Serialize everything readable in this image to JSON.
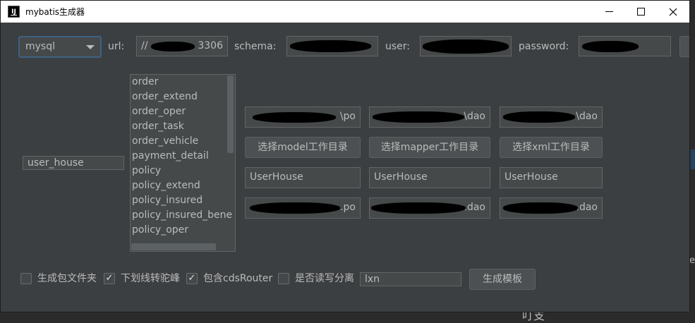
{
  "window": {
    "title": "mybatis生成器",
    "icon_text": "IJ",
    "minimize_icon": "minimize-icon",
    "maximize_icon": "maximize-icon",
    "close_icon": "close-icon"
  },
  "connection": {
    "db_type": "mysql",
    "url_label": "url:",
    "url_value": "//",
    "url_suffix": "3306",
    "schema_label": "schema:",
    "user_label": "user:",
    "password_label": "password:"
  },
  "table_input": "user_house",
  "tables": [
    "order",
    "order_extend",
    "order_oper",
    "order_task",
    "order_vehicle",
    "payment_detail",
    "policy",
    "policy_extend",
    "policy_insured",
    "policy_insured_bene",
    "policy_oper"
  ],
  "paths": {
    "model_dir_suffix": "\\po",
    "mapper_dir_suffix": "\\dao",
    "xml_dir_suffix": "\\dao"
  },
  "buttons": {
    "choose_model": "选择model工作目录",
    "choose_mapper": "选择mapper工作目录",
    "choose_xml": "选择xml工作目录",
    "generate": "生成模板"
  },
  "names": {
    "model_name": "UserHouse",
    "mapper_name": "UserHouse",
    "xml_name": "UserHouse"
  },
  "packages": {
    "model_pkg_suffix": ".po",
    "mapper_pkg_suffix": ".dao",
    "xml_pkg_suffix": ".dao"
  },
  "options": {
    "gen_pkg_folder": {
      "label": "生成包文件夹",
      "checked": false
    },
    "underscore_camel": {
      "label": "下划线转驼峰",
      "checked": true
    },
    "include_cds_router": {
      "label": "包含cdsRouter",
      "checked": true
    },
    "rw_split": {
      "label": "是否读写分离",
      "checked": false
    },
    "author": "lxn"
  },
  "background": {
    "edge_text": "e",
    "bottom_text": "叮支"
  }
}
